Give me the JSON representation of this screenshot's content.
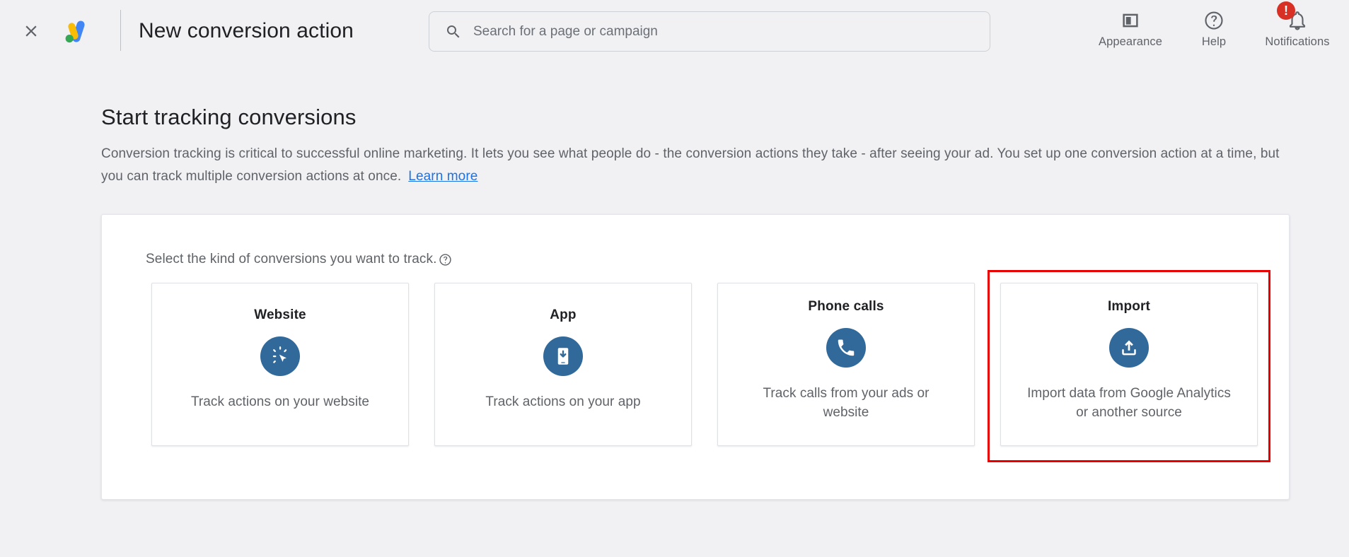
{
  "header": {
    "close_icon": "close-icon",
    "logo": "google-ads-logo",
    "title": "New conversion action",
    "search": {
      "icon": "search-icon",
      "placeholder": "Search for a page or campaign",
      "value": ""
    },
    "actions": [
      {
        "id": "appearance",
        "icon": "appearance-layout-icon",
        "label": "Appearance"
      },
      {
        "id": "help",
        "icon": "help-circle-icon",
        "label": "Help"
      },
      {
        "id": "notifications",
        "icon": "bell-icon",
        "label": "Notifications",
        "badge": "!"
      }
    ]
  },
  "main": {
    "section_title": "Start tracking conversions",
    "description": "Conversion tracking is critical to successful online marketing. It lets you see what people do - the conversion actions they take - after seeing your ad. You set up one conversion action at a time, but you can track multiple conversion actions at once.",
    "learn_more": "Learn more",
    "panel": {
      "label": "Select the kind of conversions you want to track.",
      "help_icon": "help-circle-icon",
      "cards": [
        {
          "id": "website",
          "title": "Website",
          "icon": "cursor-click-icon",
          "description": "Track actions on your website",
          "highlighted": false
        },
        {
          "id": "app",
          "title": "App",
          "icon": "mobile-download-icon",
          "description": "Track actions on your app",
          "highlighted": false
        },
        {
          "id": "phone-calls",
          "title": "Phone calls",
          "icon": "phone-icon",
          "description": "Track calls from your ads or website",
          "highlighted": false
        },
        {
          "id": "import",
          "title": "Import",
          "icon": "upload-icon",
          "description": "Import data from Google Analytics or another source",
          "highlighted": true
        }
      ]
    }
  },
  "colors": {
    "page_background": "#f1f1f4",
    "panel_background": "#ffffff",
    "icon_circle_blue": "#31699b",
    "link_blue": "#1a73e8",
    "highlight_red": "#e60000",
    "badge_red": "#d93025",
    "text_primary": "#202124",
    "text_secondary": "#5f6368"
  }
}
